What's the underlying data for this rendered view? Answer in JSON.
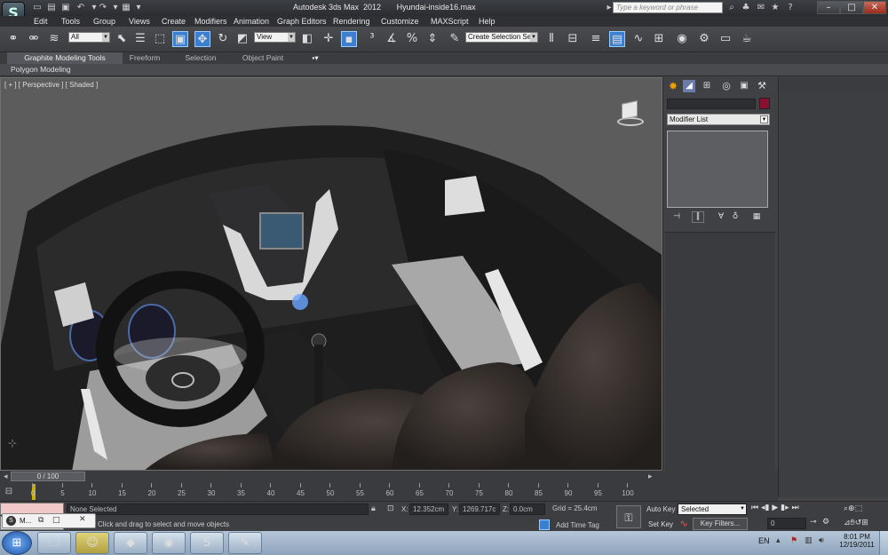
{
  "window": {
    "title": "Autodesk 3ds Max  2012       Hyundai-inside16.max",
    "search_placeholder": "Type a keyword or phrase",
    "minimize_label": "–",
    "maximize_label": "□",
    "close_label": "✕"
  },
  "menu": [
    "Edit",
    "Tools",
    "Group",
    "Views",
    "Create",
    "Modifiers",
    "Animation",
    "Graph Editors",
    "Rendering",
    "Customize",
    "MAXScript",
    "Help"
  ],
  "toolbar": {
    "selection_filter": "All",
    "reference_coord": "View",
    "named_selection": "Create Selection Se"
  },
  "ribbon": {
    "tabs": [
      "Graphite Modeling Tools",
      "Freeform",
      "Selection",
      "Object Paint"
    ],
    "sub_label": "Polygon Modeling"
  },
  "viewport": {
    "label": "[ + ] [ Perspective ] [ Shaded ]",
    "steering_logo": "Ⓗ"
  },
  "command_panel": {
    "modifier_list": "Modifier List"
  },
  "timeline": {
    "frame_counter": "0 / 100",
    "ticks": [
      "0",
      "5",
      "10",
      "15",
      "20",
      "25",
      "30",
      "35",
      "40",
      "45",
      "50",
      "55",
      "60",
      "65",
      "70",
      "75",
      "80",
      "85",
      "90",
      "95",
      "100"
    ]
  },
  "status": {
    "mini_listener": "M...",
    "selection_status": "None Selected",
    "prompt": "Click and drag to select and move objects",
    "x_label": "X:",
    "x_value": "12.352cm",
    "y_label": "Y:",
    "y_value": "1269.717c",
    "z_label": "Z:",
    "z_value": "0.0cm",
    "grid": "Grid = 25.4cm",
    "add_time_tag": "Add Time Tag",
    "auto_key": "Auto Key",
    "auto_key_mode": "Selected",
    "set_key": "Set Key",
    "key_filters": "Key Filters...",
    "current_frame": "0"
  },
  "taskbar": {
    "lang": "EN",
    "time": "8:01 PM",
    "date": "12/19/2011"
  },
  "colors": {
    "accent_swatch": "#8a1030",
    "timeline_bar": "#c8b000",
    "autokey_red": "#c04040"
  }
}
